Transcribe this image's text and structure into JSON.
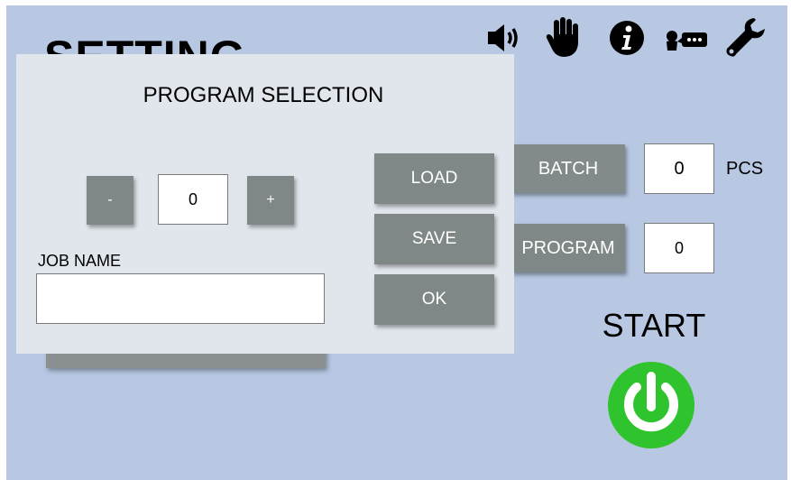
{
  "screen": {
    "title": "SETTING",
    "start_label": "START"
  },
  "toolbar": {
    "icons": [
      "speaker-icon",
      "hand-icon",
      "info-icon",
      "speech-icon",
      "wrench-icon"
    ]
  },
  "right_panel": {
    "batch_label": "BATCH",
    "batch_value": "0",
    "batch_unit": "PCS",
    "program_label": "PROGRAM",
    "program_value": "0"
  },
  "dialog": {
    "title": "PROGRAM SELECTION",
    "minus_label": "-",
    "plus_label": "+",
    "program_number": "0",
    "job_name_label": "JOB NAME",
    "job_name_value": "",
    "load_label": "LOAD",
    "save_label": "SAVE",
    "ok_label": "OK"
  },
  "colors": {
    "background": "#b8c8e3",
    "dialog": "#e1e5ec",
    "button": "#808887",
    "start_green": "#2fc42d"
  }
}
